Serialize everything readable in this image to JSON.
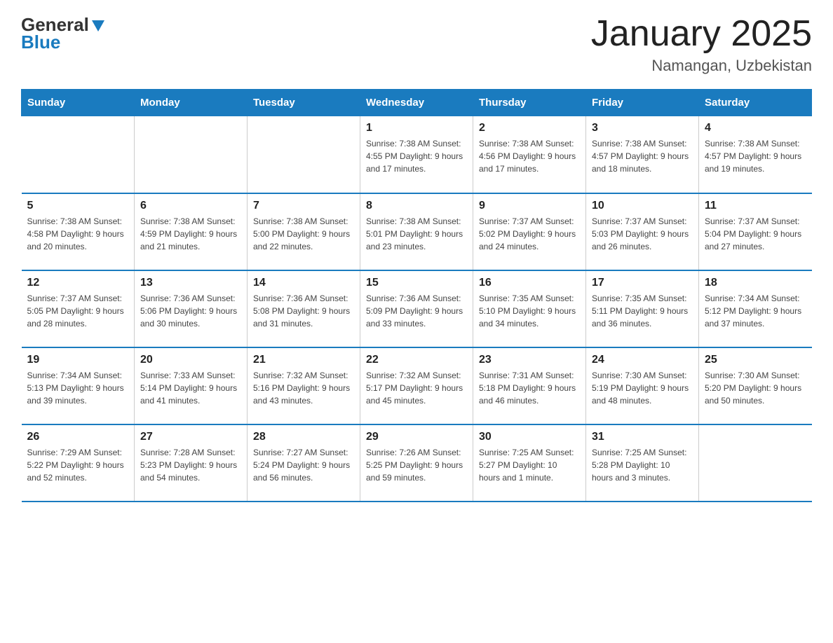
{
  "header": {
    "logo_general": "General",
    "logo_blue": "Blue",
    "title": "January 2025",
    "location": "Namangan, Uzbekistan"
  },
  "days_of_week": [
    "Sunday",
    "Monday",
    "Tuesday",
    "Wednesday",
    "Thursday",
    "Friday",
    "Saturday"
  ],
  "weeks": [
    [
      {
        "day": "",
        "info": ""
      },
      {
        "day": "",
        "info": ""
      },
      {
        "day": "",
        "info": ""
      },
      {
        "day": "1",
        "info": "Sunrise: 7:38 AM\nSunset: 4:55 PM\nDaylight: 9 hours\nand 17 minutes."
      },
      {
        "day": "2",
        "info": "Sunrise: 7:38 AM\nSunset: 4:56 PM\nDaylight: 9 hours\nand 17 minutes."
      },
      {
        "day": "3",
        "info": "Sunrise: 7:38 AM\nSunset: 4:57 PM\nDaylight: 9 hours\nand 18 minutes."
      },
      {
        "day": "4",
        "info": "Sunrise: 7:38 AM\nSunset: 4:57 PM\nDaylight: 9 hours\nand 19 minutes."
      }
    ],
    [
      {
        "day": "5",
        "info": "Sunrise: 7:38 AM\nSunset: 4:58 PM\nDaylight: 9 hours\nand 20 minutes."
      },
      {
        "day": "6",
        "info": "Sunrise: 7:38 AM\nSunset: 4:59 PM\nDaylight: 9 hours\nand 21 minutes."
      },
      {
        "day": "7",
        "info": "Sunrise: 7:38 AM\nSunset: 5:00 PM\nDaylight: 9 hours\nand 22 minutes."
      },
      {
        "day": "8",
        "info": "Sunrise: 7:38 AM\nSunset: 5:01 PM\nDaylight: 9 hours\nand 23 minutes."
      },
      {
        "day": "9",
        "info": "Sunrise: 7:37 AM\nSunset: 5:02 PM\nDaylight: 9 hours\nand 24 minutes."
      },
      {
        "day": "10",
        "info": "Sunrise: 7:37 AM\nSunset: 5:03 PM\nDaylight: 9 hours\nand 26 minutes."
      },
      {
        "day": "11",
        "info": "Sunrise: 7:37 AM\nSunset: 5:04 PM\nDaylight: 9 hours\nand 27 minutes."
      }
    ],
    [
      {
        "day": "12",
        "info": "Sunrise: 7:37 AM\nSunset: 5:05 PM\nDaylight: 9 hours\nand 28 minutes."
      },
      {
        "day": "13",
        "info": "Sunrise: 7:36 AM\nSunset: 5:06 PM\nDaylight: 9 hours\nand 30 minutes."
      },
      {
        "day": "14",
        "info": "Sunrise: 7:36 AM\nSunset: 5:08 PM\nDaylight: 9 hours\nand 31 minutes."
      },
      {
        "day": "15",
        "info": "Sunrise: 7:36 AM\nSunset: 5:09 PM\nDaylight: 9 hours\nand 33 minutes."
      },
      {
        "day": "16",
        "info": "Sunrise: 7:35 AM\nSunset: 5:10 PM\nDaylight: 9 hours\nand 34 minutes."
      },
      {
        "day": "17",
        "info": "Sunrise: 7:35 AM\nSunset: 5:11 PM\nDaylight: 9 hours\nand 36 minutes."
      },
      {
        "day": "18",
        "info": "Sunrise: 7:34 AM\nSunset: 5:12 PM\nDaylight: 9 hours\nand 37 minutes."
      }
    ],
    [
      {
        "day": "19",
        "info": "Sunrise: 7:34 AM\nSunset: 5:13 PM\nDaylight: 9 hours\nand 39 minutes."
      },
      {
        "day": "20",
        "info": "Sunrise: 7:33 AM\nSunset: 5:14 PM\nDaylight: 9 hours\nand 41 minutes."
      },
      {
        "day": "21",
        "info": "Sunrise: 7:32 AM\nSunset: 5:16 PM\nDaylight: 9 hours\nand 43 minutes."
      },
      {
        "day": "22",
        "info": "Sunrise: 7:32 AM\nSunset: 5:17 PM\nDaylight: 9 hours\nand 45 minutes."
      },
      {
        "day": "23",
        "info": "Sunrise: 7:31 AM\nSunset: 5:18 PM\nDaylight: 9 hours\nand 46 minutes."
      },
      {
        "day": "24",
        "info": "Sunrise: 7:30 AM\nSunset: 5:19 PM\nDaylight: 9 hours\nand 48 minutes."
      },
      {
        "day": "25",
        "info": "Sunrise: 7:30 AM\nSunset: 5:20 PM\nDaylight: 9 hours\nand 50 minutes."
      }
    ],
    [
      {
        "day": "26",
        "info": "Sunrise: 7:29 AM\nSunset: 5:22 PM\nDaylight: 9 hours\nand 52 minutes."
      },
      {
        "day": "27",
        "info": "Sunrise: 7:28 AM\nSunset: 5:23 PM\nDaylight: 9 hours\nand 54 minutes."
      },
      {
        "day": "28",
        "info": "Sunrise: 7:27 AM\nSunset: 5:24 PM\nDaylight: 9 hours\nand 56 minutes."
      },
      {
        "day": "29",
        "info": "Sunrise: 7:26 AM\nSunset: 5:25 PM\nDaylight: 9 hours\nand 59 minutes."
      },
      {
        "day": "30",
        "info": "Sunrise: 7:25 AM\nSunset: 5:27 PM\nDaylight: 10 hours\nand 1 minute."
      },
      {
        "day": "31",
        "info": "Sunrise: 7:25 AM\nSunset: 5:28 PM\nDaylight: 10 hours\nand 3 minutes."
      },
      {
        "day": "",
        "info": ""
      }
    ]
  ]
}
